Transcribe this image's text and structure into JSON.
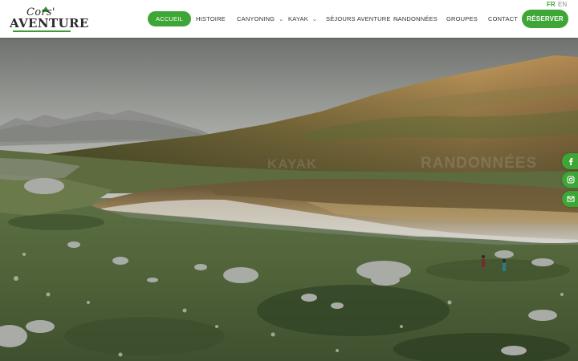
{
  "brand": {
    "logo_top": "Cors'",
    "logo_main": "AVENTURE"
  },
  "nav": {
    "items": [
      {
        "label": "ACCUEIL",
        "active": true,
        "dropdown": false
      },
      {
        "label": "HISTOIRE",
        "active": false,
        "dropdown": false
      },
      {
        "label": "CANYONING",
        "active": false,
        "dropdown": true
      },
      {
        "label": "KAYAK",
        "active": false,
        "dropdown": true
      },
      {
        "label": "SÉJOURS AVENTURE",
        "active": false,
        "dropdown": true
      },
      {
        "label": "RANDONNÉES",
        "active": false,
        "dropdown": false
      },
      {
        "label": "GROUPES",
        "active": false,
        "dropdown": false
      },
      {
        "label": "CONTACT",
        "active": false,
        "dropdown": false
      }
    ],
    "reserve_label": "RÉSERVER"
  },
  "languages": {
    "fr": "FR",
    "en": "EN",
    "selected": "FR"
  },
  "hero": {
    "labels": {
      "kayak": "KAYAK",
      "randonnees": "RANDONNÉES"
    }
  },
  "social": {
    "icons": [
      "facebook-icon",
      "instagram-icon",
      "email-icon"
    ]
  },
  "colors": {
    "accent": "#3ea636",
    "text": "#333333"
  }
}
